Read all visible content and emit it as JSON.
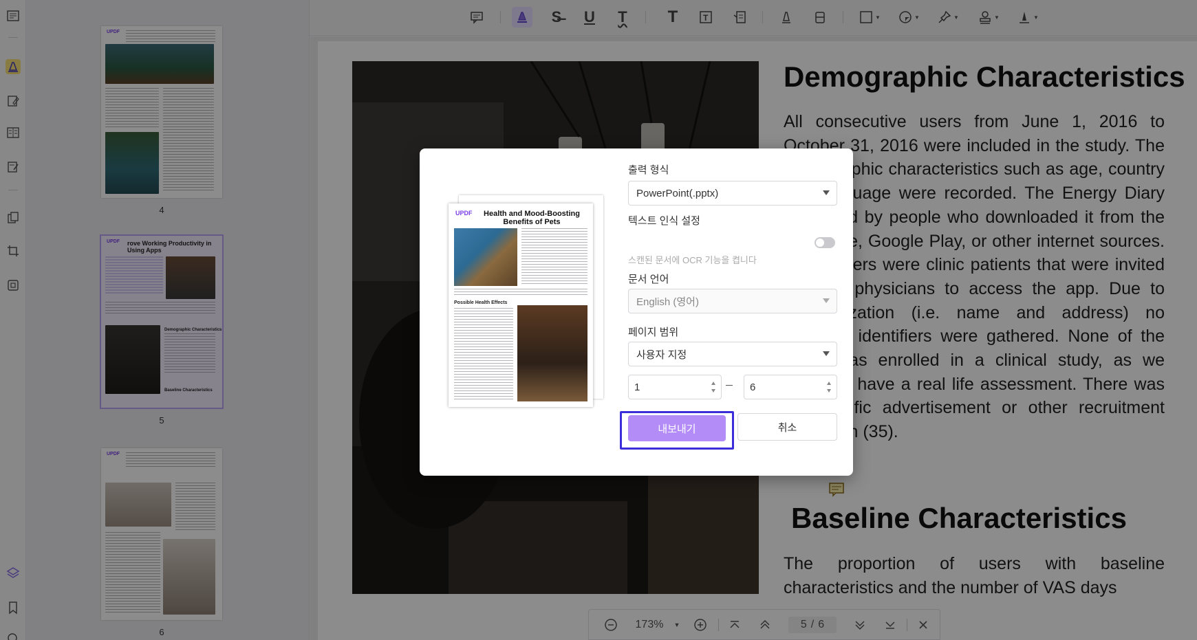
{
  "toolbar": {
    "icons": [
      "comment-icon",
      "highlight-icon",
      "strikethrough-icon",
      "underline-icon",
      "squiggly-icon",
      "text-icon",
      "text-box-icon",
      "text-callout-icon",
      "pencil-icon",
      "eraser-icon",
      "shape-icon",
      "sticker-icon",
      "pin-icon",
      "stamp-icon",
      "signature-icon"
    ]
  },
  "sidebar": {
    "thumbnails": [
      {
        "page": "4",
        "title": ""
      },
      {
        "page": "5",
        "title": "rove Working Productivity in Using Apps",
        "subtitle1": "Demographic Characteristics",
        "subtitle2": "Baseline Characteristics"
      },
      {
        "page": "6",
        "title": ""
      }
    ],
    "logo": "UPDF"
  },
  "document": {
    "heading1": "Demographic Characteristics",
    "paragraph1": "All consecutive users from June 1, 2016 to October 31, 2016 were included in the study. The demographic characteristics such as age, country and language were recorded. The Energy Diary was used by people who downloaded it from the App store, Google Play, or other internet sources. Some users were clinic patients that were invited by their physicians to access the app. Due to anonymization (i.e. name and address) no personal identifiers were gathered. None of the users was enrolled in a clinical study, as we aimed to have a real life assessment. There was no specific advertisement or other recruitment campaign (35).",
    "heading2": "Baseline Characteristics",
    "paragraph2": "The proportion of users with baseline characteristics and the number of VAS days"
  },
  "dialog": {
    "output_format_label": "출력 형식",
    "output_format_value": "PowerPoint(.pptx)",
    "ocr_label": "텍스트 인식 설정",
    "ocr_hint": "스캔된 문서에 OCR 기능을 켭니다",
    "ocr_enabled": false,
    "doc_language_label": "문서 언어",
    "doc_language_value": "English (영어)",
    "page_range_label": "페이지 범위",
    "page_range_value": "사용자 지정",
    "range_from": "1",
    "range_to": "6",
    "export_button": "내보내기",
    "cancel_button": "취소",
    "preview": {
      "logo": "UPDF",
      "title": "Health and Mood-Boosting Benefits of Pets",
      "section": "Possible Health Effects"
    }
  },
  "zoombar": {
    "zoom": "173%",
    "current_page": "5",
    "separator": "/",
    "total_pages": "6"
  },
  "colors": {
    "accent": "#b48cf7",
    "focus_ring": "#3b2ed8"
  }
}
